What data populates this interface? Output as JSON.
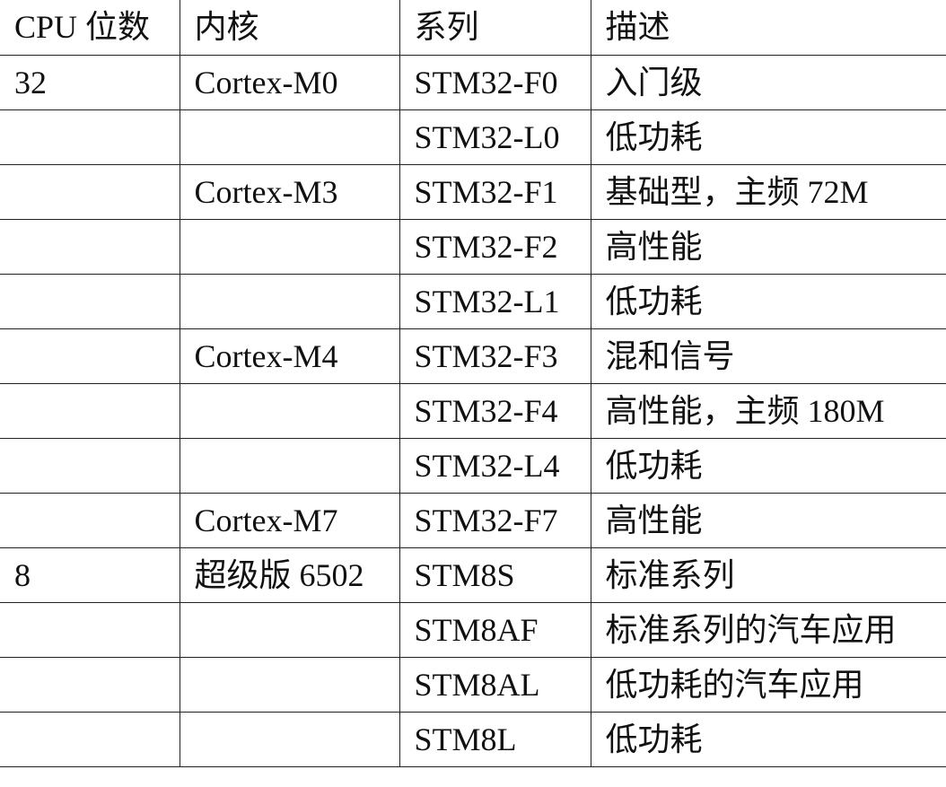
{
  "table": {
    "headers": [
      "CPU 位数",
      "内核",
      "系列",
      "描述"
    ],
    "rows": [
      [
        "32",
        "Cortex-M0",
        "STM32-F0",
        "入门级"
      ],
      [
        "",
        "",
        "STM32-L0",
        "低功耗"
      ],
      [
        "",
        "Cortex-M3",
        "STM32-F1",
        "基础型，主频 72M"
      ],
      [
        "",
        "",
        "STM32-F2",
        "高性能"
      ],
      [
        "",
        "",
        "STM32-L1",
        "低功耗"
      ],
      [
        "",
        "Cortex-M4",
        "STM32-F3",
        "混和信号"
      ],
      [
        "",
        "",
        "STM32-F4",
        "高性能，主频 180M"
      ],
      [
        "",
        "",
        "STM32-L4",
        "低功耗"
      ],
      [
        "",
        "Cortex-M7",
        "STM32-F7",
        "高性能"
      ],
      [
        "8",
        "超级版 6502",
        "STM8S",
        "标准系列"
      ],
      [
        "",
        "",
        "STM8AF",
        "标准系列的汽车应用"
      ],
      [
        "",
        "",
        "STM8AL",
        "低功耗的汽车应用"
      ],
      [
        "",
        "",
        "STM8L",
        "低功耗"
      ]
    ]
  }
}
